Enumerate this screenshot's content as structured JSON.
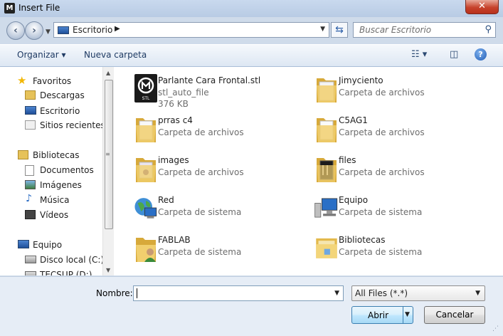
{
  "window": {
    "title": "Insert File",
    "close_glyph": "✕"
  },
  "nav": {
    "path": [
      "Escritorio"
    ],
    "search_placeholder": "Buscar Escritorio"
  },
  "toolbar": {
    "organize_label": "Organizar",
    "new_folder_label": "Nueva carpeta"
  },
  "sidebar": {
    "favorites": {
      "label": "Favoritos",
      "items": [
        "Descargas",
        "Escritorio",
        "Sitios recientes"
      ]
    },
    "libraries": {
      "label": "Bibliotecas",
      "items": [
        "Documentos",
        "Imágenes",
        "Música",
        "Vídeos"
      ]
    },
    "computer": {
      "label": "Equipo",
      "items": [
        "Disco local (C:)",
        "TECSUP (D:)"
      ]
    }
  },
  "files": [
    {
      "name": "Parlante Cara Frontal.stl",
      "sub1": "stl_auto_file",
      "sub2": "376 KB",
      "icon": "stl-file-icon"
    },
    {
      "name": "Jimyciento",
      "sub1": "Carpeta de archivos",
      "sub2": "",
      "icon": "folder-icon"
    },
    {
      "name": "prras c4",
      "sub1": "Carpeta de archivos",
      "sub2": "",
      "icon": "folder-icon"
    },
    {
      "name": "C5AG1",
      "sub1": "Carpeta de archivos",
      "sub2": "",
      "icon": "folder-icon"
    },
    {
      "name": "images",
      "sub1": "Carpeta de archivos",
      "sub2": "",
      "icon": "folder-icon"
    },
    {
      "name": "files",
      "sub1": "Carpeta de archivos",
      "sub2": "",
      "icon": "folder-icon"
    },
    {
      "name": "Red",
      "sub1": "Carpeta de sistema",
      "sub2": "",
      "icon": "network-icon"
    },
    {
      "name": "Equipo",
      "sub1": "Carpeta de sistema",
      "sub2": "",
      "icon": "computer-icon"
    },
    {
      "name": "FABLAB",
      "sub1": "Carpeta de sistema",
      "sub2": "",
      "icon": "user-folder-icon"
    },
    {
      "name": "Bibliotecas",
      "sub1": "Carpeta de sistema",
      "sub2": "",
      "icon": "libraries-icon"
    }
  ],
  "bottom": {
    "name_label": "Nombre:",
    "name_value": "",
    "file_type": "All Files (*.*)",
    "open_label": "Abrir",
    "cancel_label": "Cancelar"
  }
}
